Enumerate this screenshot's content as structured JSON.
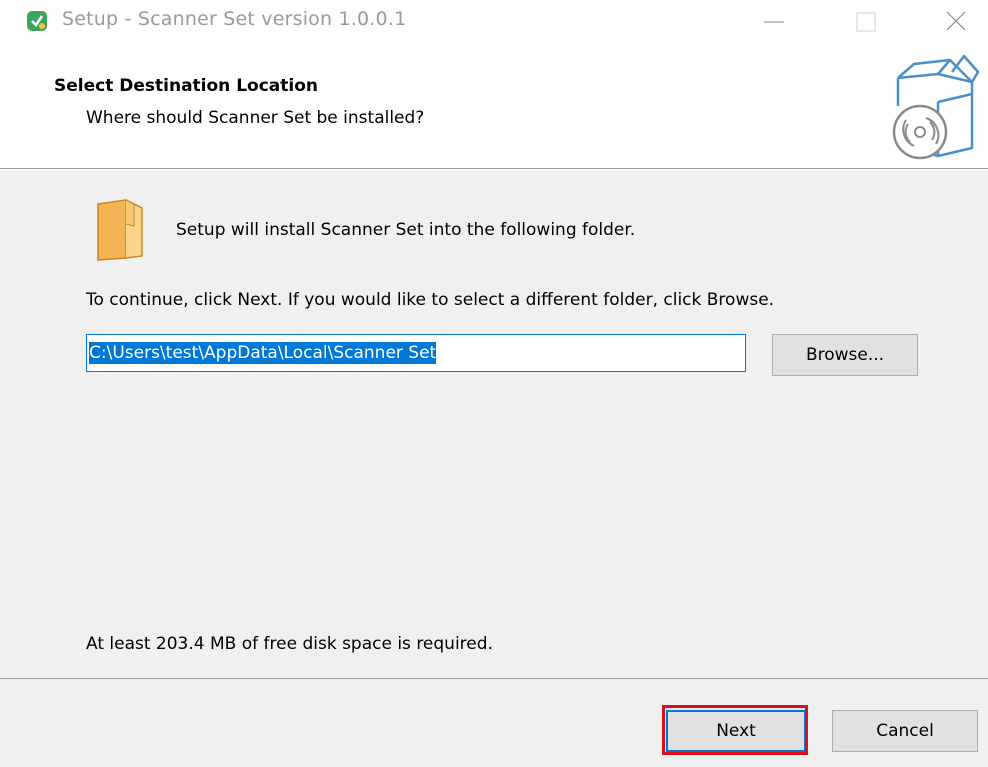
{
  "window": {
    "title": "Setup - Scanner Set version 1.0.0.1"
  },
  "header": {
    "title": "Select Destination Location",
    "subtitle": "Where should Scanner Set be installed?"
  },
  "content": {
    "intro": "Setup will install Scanner Set into the following folder.",
    "instruction": "To continue, click Next. If you would like to select a different folder, click Browse.",
    "install_path": "C:\\Users\\test\\AppData\\Local\\Scanner Set",
    "browse_label": "Browse...",
    "disk_space_note": "At least 203.4 MB of free disk space is required."
  },
  "footer": {
    "next_label": "Next",
    "cancel_label": "Cancel"
  },
  "icons": {
    "app": "setup-app-icon",
    "header": "software-box-disc-icon",
    "folder": "folder-icon"
  },
  "colors": {
    "accent": "#0078d7",
    "highlight": "#e0101a",
    "panel": "#f0f0f0"
  }
}
